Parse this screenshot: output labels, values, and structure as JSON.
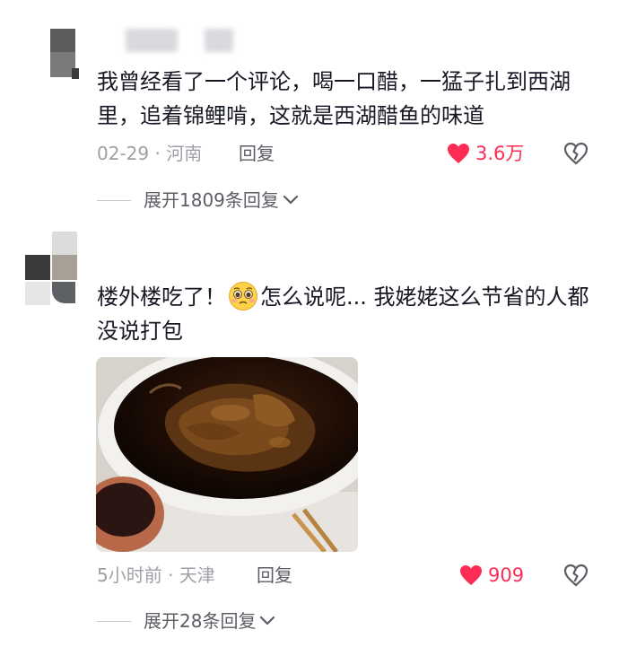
{
  "comments": [
    {
      "text": "我曾经看了一个评论，喝一口醋，一猛子扎到西湖里，追着锦鲤啃，这就是西湖醋鱼的味道",
      "date": "02-29",
      "location": "河南",
      "reply_label": "回复",
      "likes": "3.6万",
      "expand_label": "展开1809条回复",
      "avatar_colors": [
        "#5a5a5a",
        "#757575",
        "#e8e8e8"
      ]
    },
    {
      "text_before": "楼外楼吃了！",
      "emoji": "pleading-face-emoji",
      "text_after": "怎么说呢... 我姥姥这么节省的人都没说打包",
      "date": "5小时前",
      "location": "天津",
      "reply_label": "回复",
      "likes": "909",
      "expand_label": "展开28条回复",
      "avatar_colors": [
        "#3a3a3a",
        "#a8a09a",
        "#dddddd",
        "#5b5e63"
      ],
      "photo": "dish-of-west-lake-vinegar-fish-photo"
    }
  ],
  "colors": {
    "like": "#fe2c55",
    "meta": "#9ea0a7",
    "text": "#161823"
  }
}
